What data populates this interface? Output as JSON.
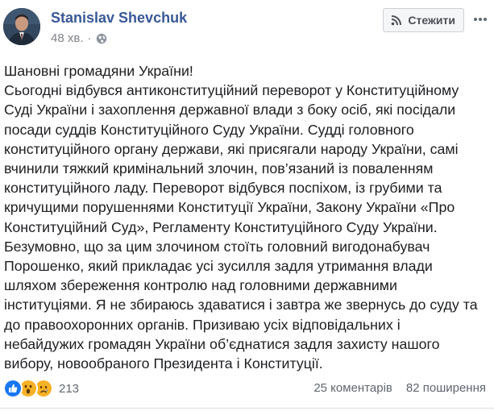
{
  "author": {
    "name": "Stanislav Shevchuk",
    "time": "48 хв.",
    "separator": "·",
    "privacy_icon": "globe-icon"
  },
  "actions": {
    "follow_label": "Стежити",
    "follow_icon": "rss-icon",
    "more_icon": "more-dots-icon"
  },
  "post": {
    "lines": [
      "Шановні громадяни України!",
      "Сьогодні відбувся антиконституційний переворот у Конституційному",
      "Суді України і захоплення державної влади з боку осіб, які посідали",
      "посади суддів Конституційного Суду України. Судді головного",
      "конституційного органу держави, які присягали народу України, самі",
      "вчинили тяжкий кримінальний злочин, пов’язаний із поваленням",
      "конституційного ладу. Переворот відбувся поспіхом, із грубими та",
      "кричущими порушеннями Конституції України, Закону України «Про",
      "Конституційний Суд», Регламенту Конституційного Суду України.",
      "Безумовно, що за цим злочином стоїть головний вигодонабувач",
      "Порошенко, який прикладає усі зусилля задля утримання влади",
      "шляхом збереження контролю над головними державними",
      "інституціями. Я не збираюсь здаватися і завтра же звернусь до суду та",
      "до правоохоронних органів. Призиваю усіх відповідальних і",
      "небайдужих громадян України об’єднатися задля захисту нашого",
      "вибору, новообраного Президента і Конституції."
    ]
  },
  "footer": {
    "reaction_icons": [
      "like-icon",
      "wow-icon",
      "sad-icon"
    ],
    "reaction_count": "213",
    "comments": "25 коментарів",
    "shares": "82 поширення"
  },
  "colors": {
    "author": "#385898",
    "like": "#1877f2",
    "emoji": "#f7b125",
    "meta": "#7f8389"
  }
}
